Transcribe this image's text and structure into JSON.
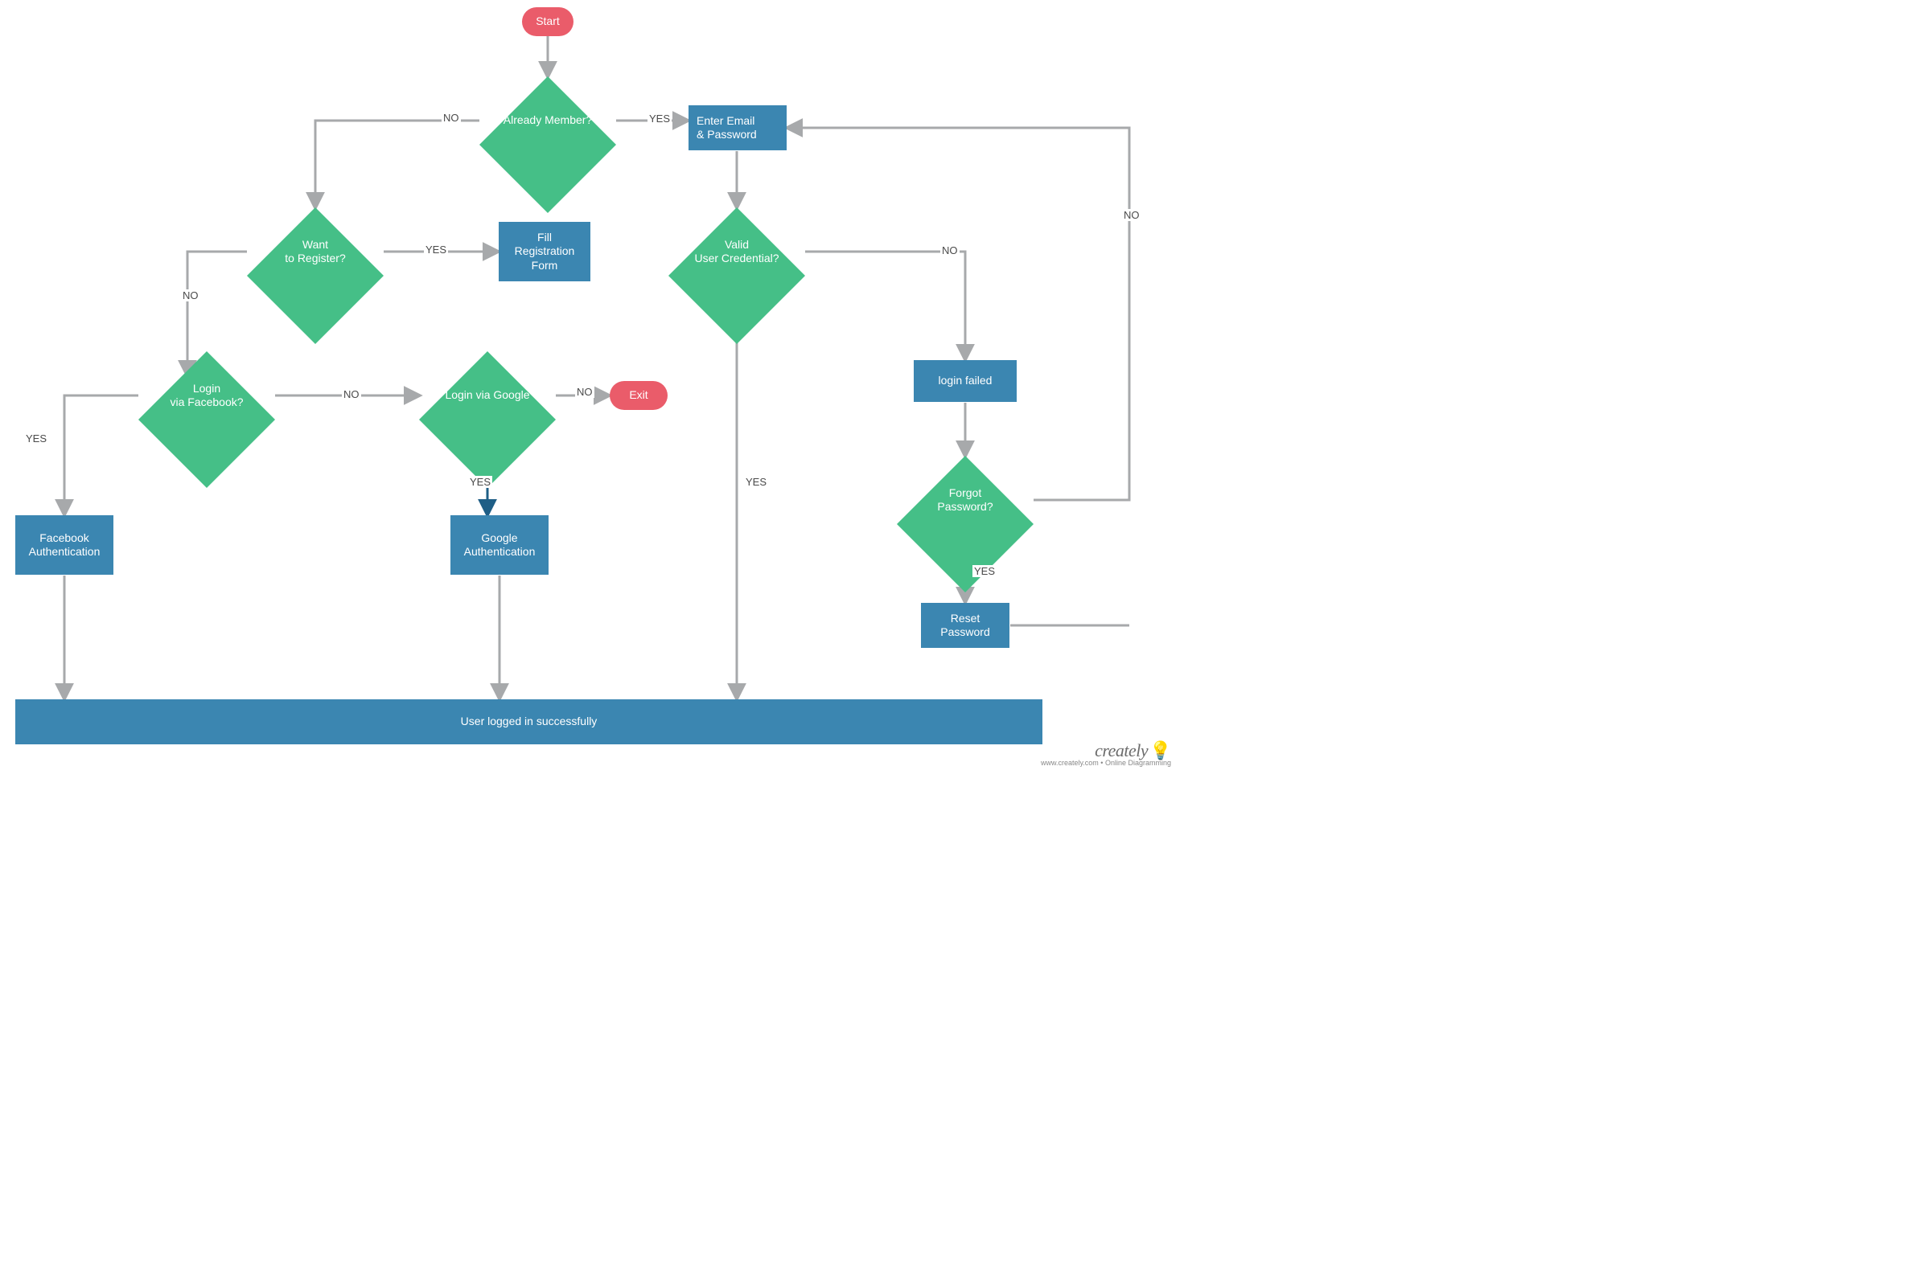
{
  "colors": {
    "terminator": "#ea5c6a",
    "decision": "#45bf87",
    "process": "#3b86b1",
    "arrow": "#a7a9ab",
    "arrow_accent": "#1e5e86"
  },
  "nodes": {
    "start": "Start",
    "already_member": "Already Member?",
    "enter_credentials_l1": "Enter Email",
    "enter_credentials_l2": "& Password",
    "want_register": "Want\nto Register?",
    "fill_reg_l1": "Fill",
    "fill_reg_l2": "Registration",
    "fill_reg_l3": "Form",
    "valid_cred": "Valid\nUser Credential?",
    "login_fb": "Login\nvia Facebook?",
    "login_google": "Login via  Google",
    "exit": "Exit",
    "login_failed": "login failed",
    "forgot_pw": "Forgot\nPassword?",
    "fb_auth_l1": "Facebook",
    "fb_auth_l2": "Authentication",
    "google_auth_l1": "Google",
    "google_auth_l2": "Authentication",
    "reset_pw_l1": "Reset",
    "reset_pw_l2": "Password",
    "success": "User logged in successfully"
  },
  "labels": {
    "yes": "YES",
    "no": "NO"
  },
  "brand": {
    "name": "creately",
    "tagline": "www.creately.com • Online Diagramming"
  }
}
